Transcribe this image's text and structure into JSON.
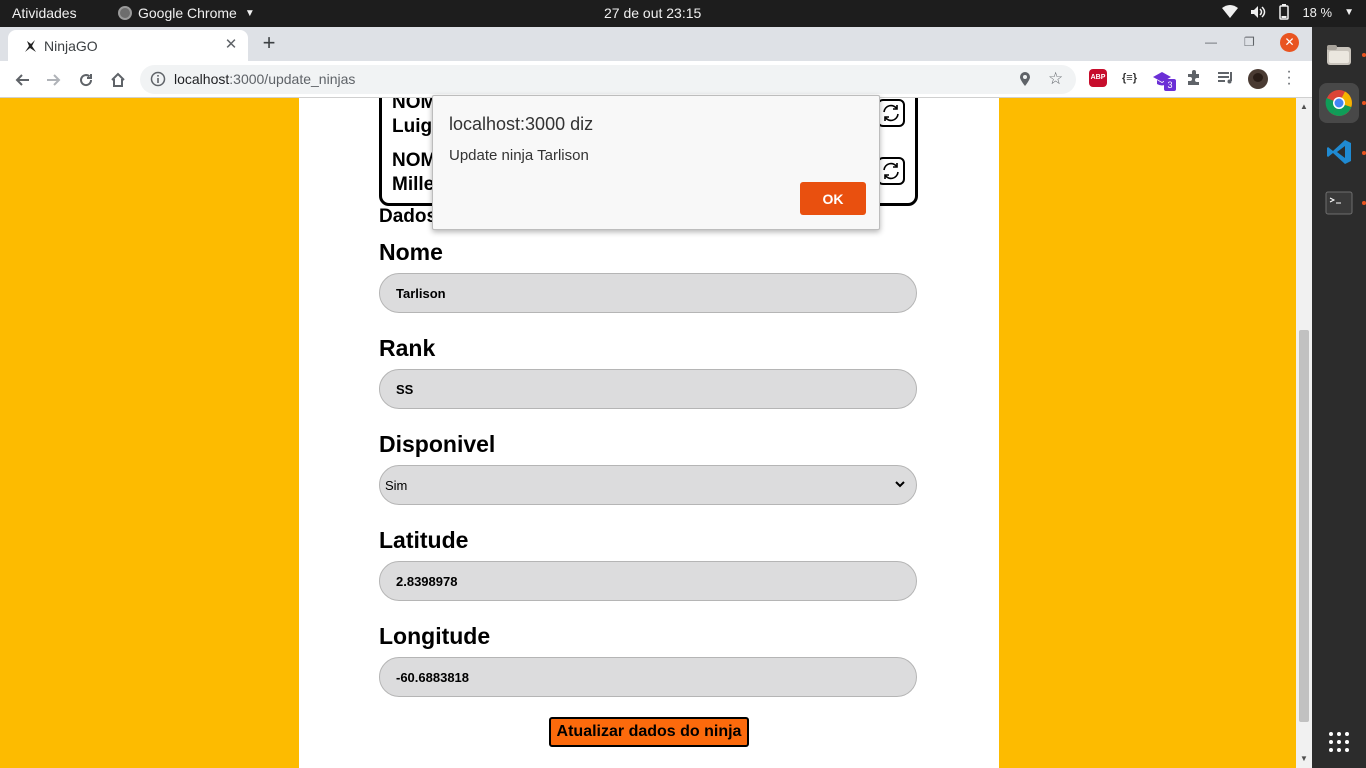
{
  "system": {
    "activities": "Atividades",
    "app_name": "Google Chrome",
    "clock": "27 de out  23:15",
    "battery": "18 %"
  },
  "browser": {
    "tab_title": "NinjaGO",
    "url_host": "localhost",
    "url_rest": ":3000/update_ninjas",
    "extension_badge": "3"
  },
  "ninja_list": {
    "items": [
      {
        "line1": "NOM",
        "line2": "Luig"
      },
      {
        "line1": "NOM",
        "line2": "Mille"
      }
    ]
  },
  "form": {
    "section_title": "Dados",
    "fields": [
      {
        "label": "Nome",
        "value": "Tarlison"
      },
      {
        "label": "Rank",
        "value": "SS"
      },
      {
        "label": "Disponivel",
        "value": "Sim"
      },
      {
        "label": "Latitude",
        "value": "2.8398978"
      },
      {
        "label": "Longitude",
        "value": "-60.6883818"
      }
    ],
    "submit_label": "Atualizar dados do ninja"
  },
  "dialog": {
    "title": "localhost:3000 diz",
    "message": "Update ninja Tarlison",
    "ok_label": "OK"
  },
  "colors": {
    "page_background": "#fdbb00",
    "submit_button": "#fc6a0c",
    "dialog_ok": "#e9500f"
  }
}
